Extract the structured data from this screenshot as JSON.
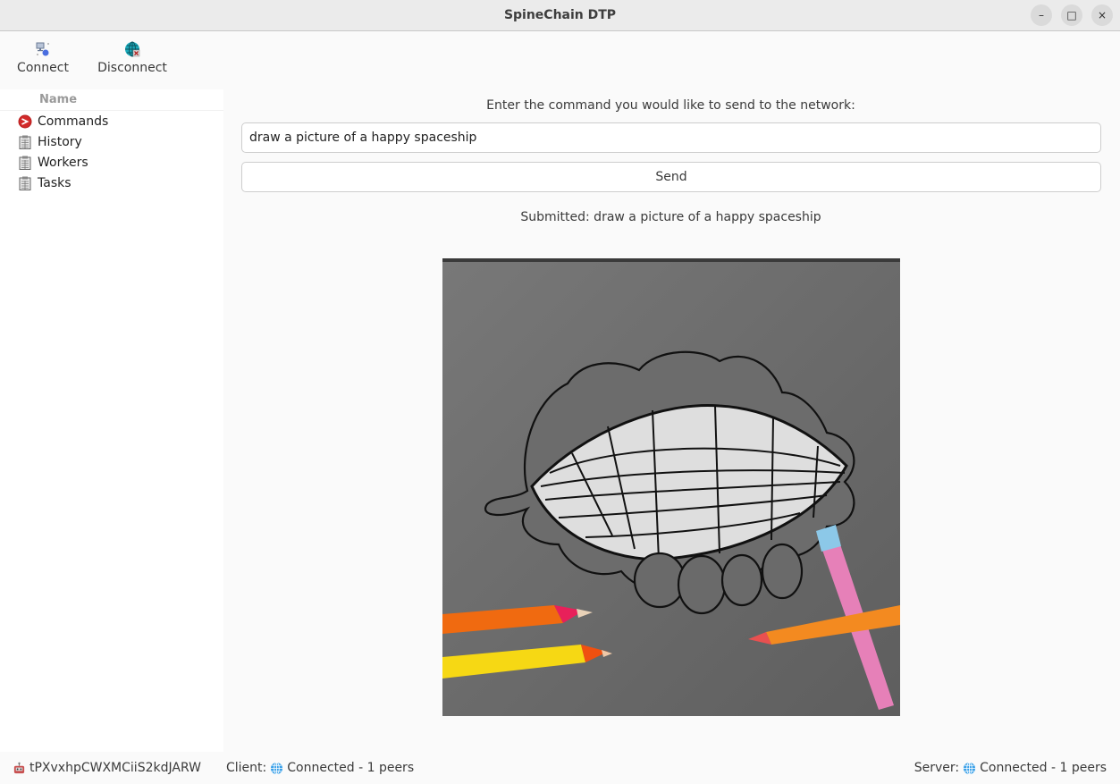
{
  "window": {
    "title": "SpineChain DTP",
    "controls": {
      "minimize": "–",
      "maximize": "□",
      "close": "×"
    }
  },
  "toolbar": {
    "connect_label": "Connect",
    "disconnect_label": "Disconnect",
    "connect_icon": "network-connect-icon",
    "disconnect_icon": "network-disconnect-icon"
  },
  "sidebar": {
    "column_header": "Name",
    "items": [
      {
        "label": "Commands",
        "icon": "terminal-icon"
      },
      {
        "label": "History",
        "icon": "clipboard-icon"
      },
      {
        "label": "Workers",
        "icon": "clipboard-icon"
      },
      {
        "label": "Tasks",
        "icon": "clipboard-icon"
      }
    ]
  },
  "main": {
    "prompt_label": "Enter the command you would like to send to the network:",
    "command_value": "draw a picture of a happy spaceship",
    "send_label": "Send",
    "submitted_text": "Submitted: draw a picture of a happy spaceship",
    "image_description": "Generated drawing: grid-lined spaceship-like shape with bumpy outline on grey paper, colored pencils around"
  },
  "statusbar": {
    "node_id": "tPXvxhpCWXMCiiS2kdJARW",
    "node_icon": "robot-icon",
    "client_prefix": "Client:",
    "client_status": "Connected - 1 peers",
    "server_prefix": "Server:",
    "server_status": "Connected - 1 peers"
  }
}
